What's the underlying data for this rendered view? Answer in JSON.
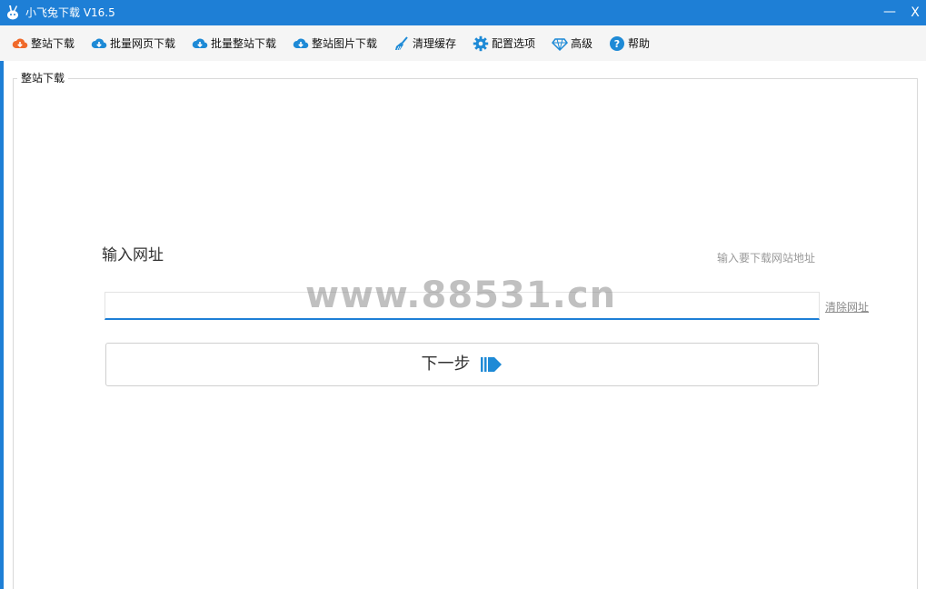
{
  "window": {
    "title": "小飞兔下载 V16.5",
    "minimize_label": "—",
    "close_label": "X"
  },
  "toolbar": {
    "items": [
      {
        "label": "整站下载",
        "icon": "download-orange-icon"
      },
      {
        "label": "批量网页下载",
        "icon": "cloud-download-icon"
      },
      {
        "label": "批量整站下载",
        "icon": "cloud-download-icon"
      },
      {
        "label": "整站图片下载",
        "icon": "cloud-download-icon"
      },
      {
        "label": "清理缓存",
        "icon": "broom-icon"
      },
      {
        "label": "配置选项",
        "icon": "gear-icon"
      },
      {
        "label": "高级",
        "icon": "diamond-icon"
      },
      {
        "label": "帮助",
        "icon": "help-icon"
      }
    ]
  },
  "panel": {
    "legend": "整站下载",
    "url_title": "输入网址",
    "url_hint": "输入要下载网站地址",
    "url_value": "",
    "clear_label": "清除网址",
    "next_label": "下一步"
  },
  "watermark": "www.88531.cn",
  "colors": {
    "accent": "#1e7fd6",
    "toolbar_bg": "#f5f5f5",
    "orange": "#f06a2b"
  }
}
